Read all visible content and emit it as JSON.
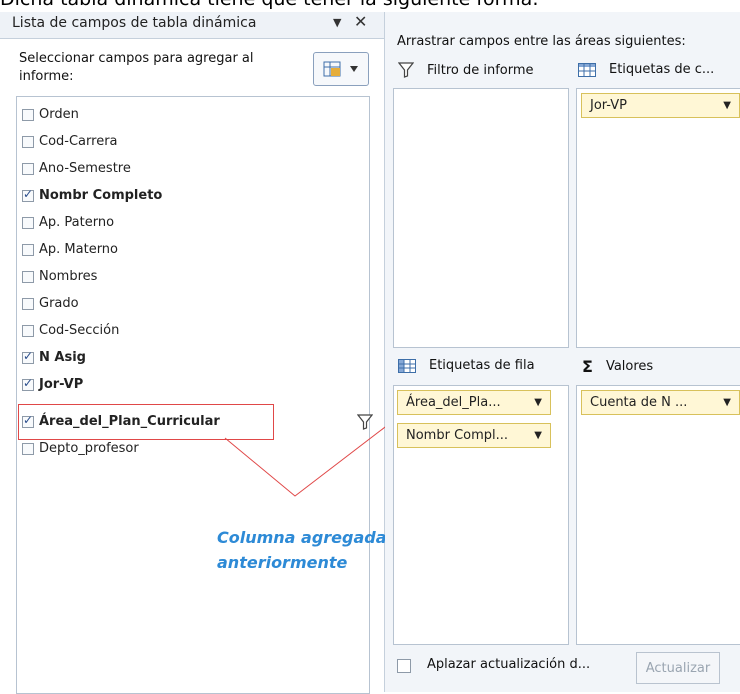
{
  "page": {
    "heading": "Dicha tabla dinámica tiene que tener la siguiente forma:"
  },
  "left_panel": {
    "title": "Lista de campos de tabla dinámica",
    "instruction": "Seleccionar campos para agregar al informe:",
    "fields": [
      {
        "label": "Orden",
        "checked": false
      },
      {
        "label": "Cod-Carrera",
        "checked": false
      },
      {
        "label": "Ano-Semestre",
        "checked": false
      },
      {
        "label": "Nombr Completo",
        "checked": true
      },
      {
        "label": "Ap. Paterno",
        "checked": false
      },
      {
        "label": "Ap. Materno",
        "checked": false
      },
      {
        "label": "Nombres",
        "checked": false
      },
      {
        "label": "Grado",
        "checked": false
      },
      {
        "label": "Cod-Sección",
        "checked": false
      },
      {
        "label": "N Asig",
        "checked": true
      },
      {
        "label": "Jor-VP",
        "checked": true
      },
      {
        "label": "Área_del_Plan_Curricular",
        "checked": true
      },
      {
        "label": "Depto_profesor",
        "checked": false
      }
    ],
    "annotation": "Columna agregada anteriormente"
  },
  "right_panel": {
    "instruction": "Arrastrar campos entre las áreas siguientes:",
    "report_filter_label": "Filtro de informe",
    "column_labels_label": "Etiquetas de c...",
    "row_labels_label": "Etiquetas de fila",
    "values_label": "Valores",
    "column_chip": "Jor-VP",
    "row_chips": [
      "Área_del_Pla...",
      "Nombr Compl..."
    ],
    "value_chip": "Cuenta de N ...",
    "defer_label": "Aplazar actualización d...",
    "update_button": "Actualizar"
  },
  "colors": {
    "annotation": "#2d8ad6",
    "highlight": "#e04848",
    "chip_bg": "#fff7d6"
  }
}
